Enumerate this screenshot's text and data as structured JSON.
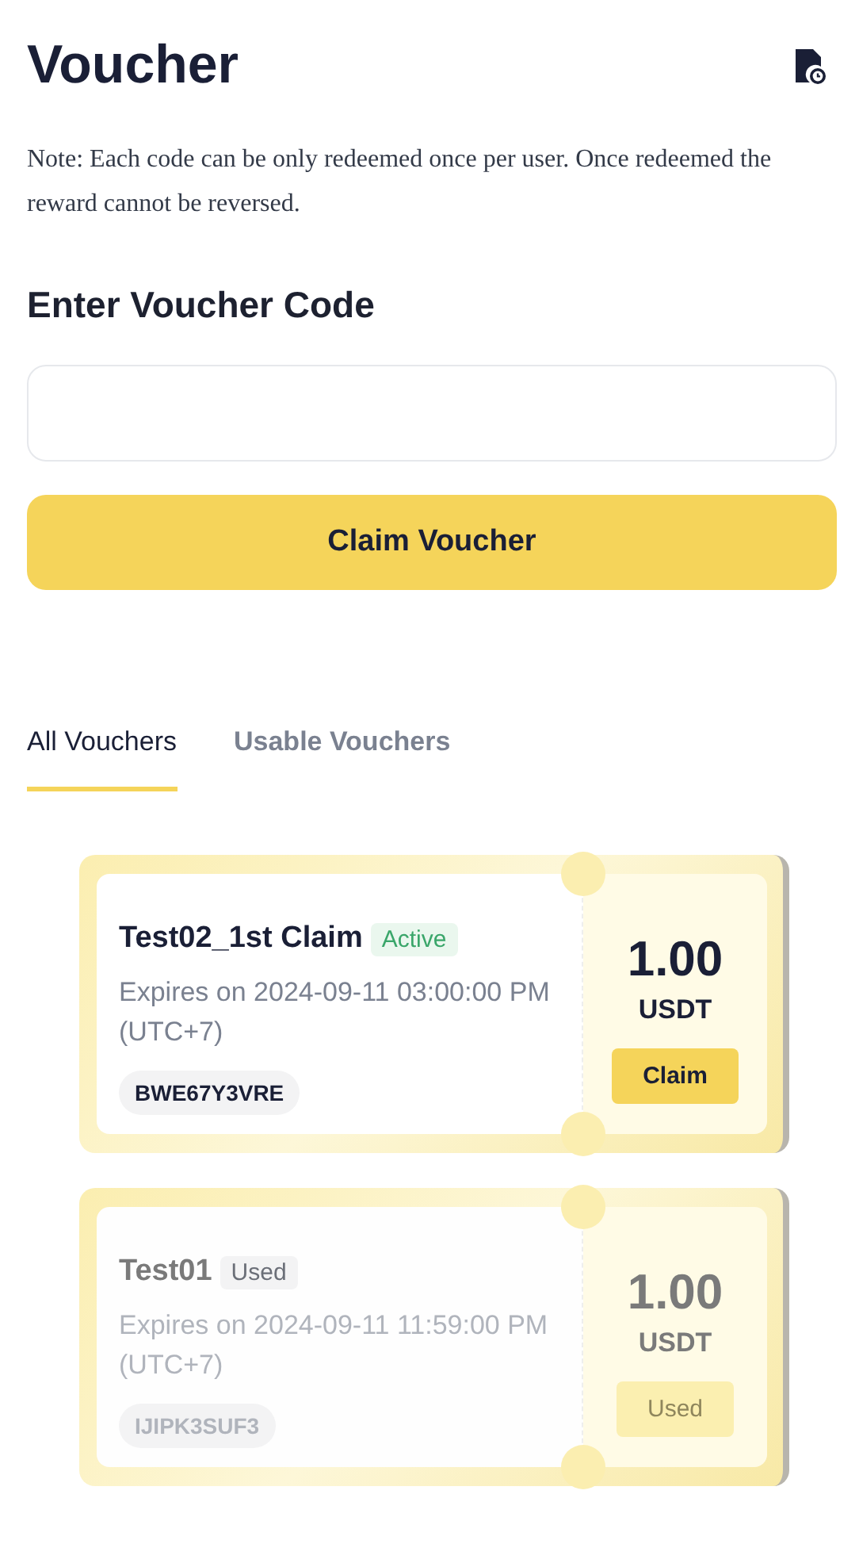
{
  "header": {
    "title": "Voucher"
  },
  "note": "Note: Each code can be only redeemed once per user. Once redeemed the reward cannot be reversed.",
  "code_section": {
    "heading": "Enter Voucher Code",
    "button": "Claim Voucher"
  },
  "tabs": [
    {
      "label": "All Vouchers",
      "selected": true
    },
    {
      "label": "Usable Vouchers",
      "selected": false
    }
  ],
  "vouchers": [
    {
      "name": "Test02_1st Claim",
      "status": "Active",
      "used": false,
      "expiry": "Expires on 2024-09-11 03:00:00 PM (UTC+7)",
      "code": "BWE67Y3VRE",
      "amount": "1.00",
      "currency": "USDT",
      "action": "Claim"
    },
    {
      "name": "Test01",
      "status": "Used",
      "used": true,
      "expiry": "Expires on 2024-09-11 11:59:00 PM (UTC+7)",
      "code": "IJIPK3SUF3",
      "amount": "1.00",
      "currency": "USDT",
      "action": "Used"
    }
  ]
}
